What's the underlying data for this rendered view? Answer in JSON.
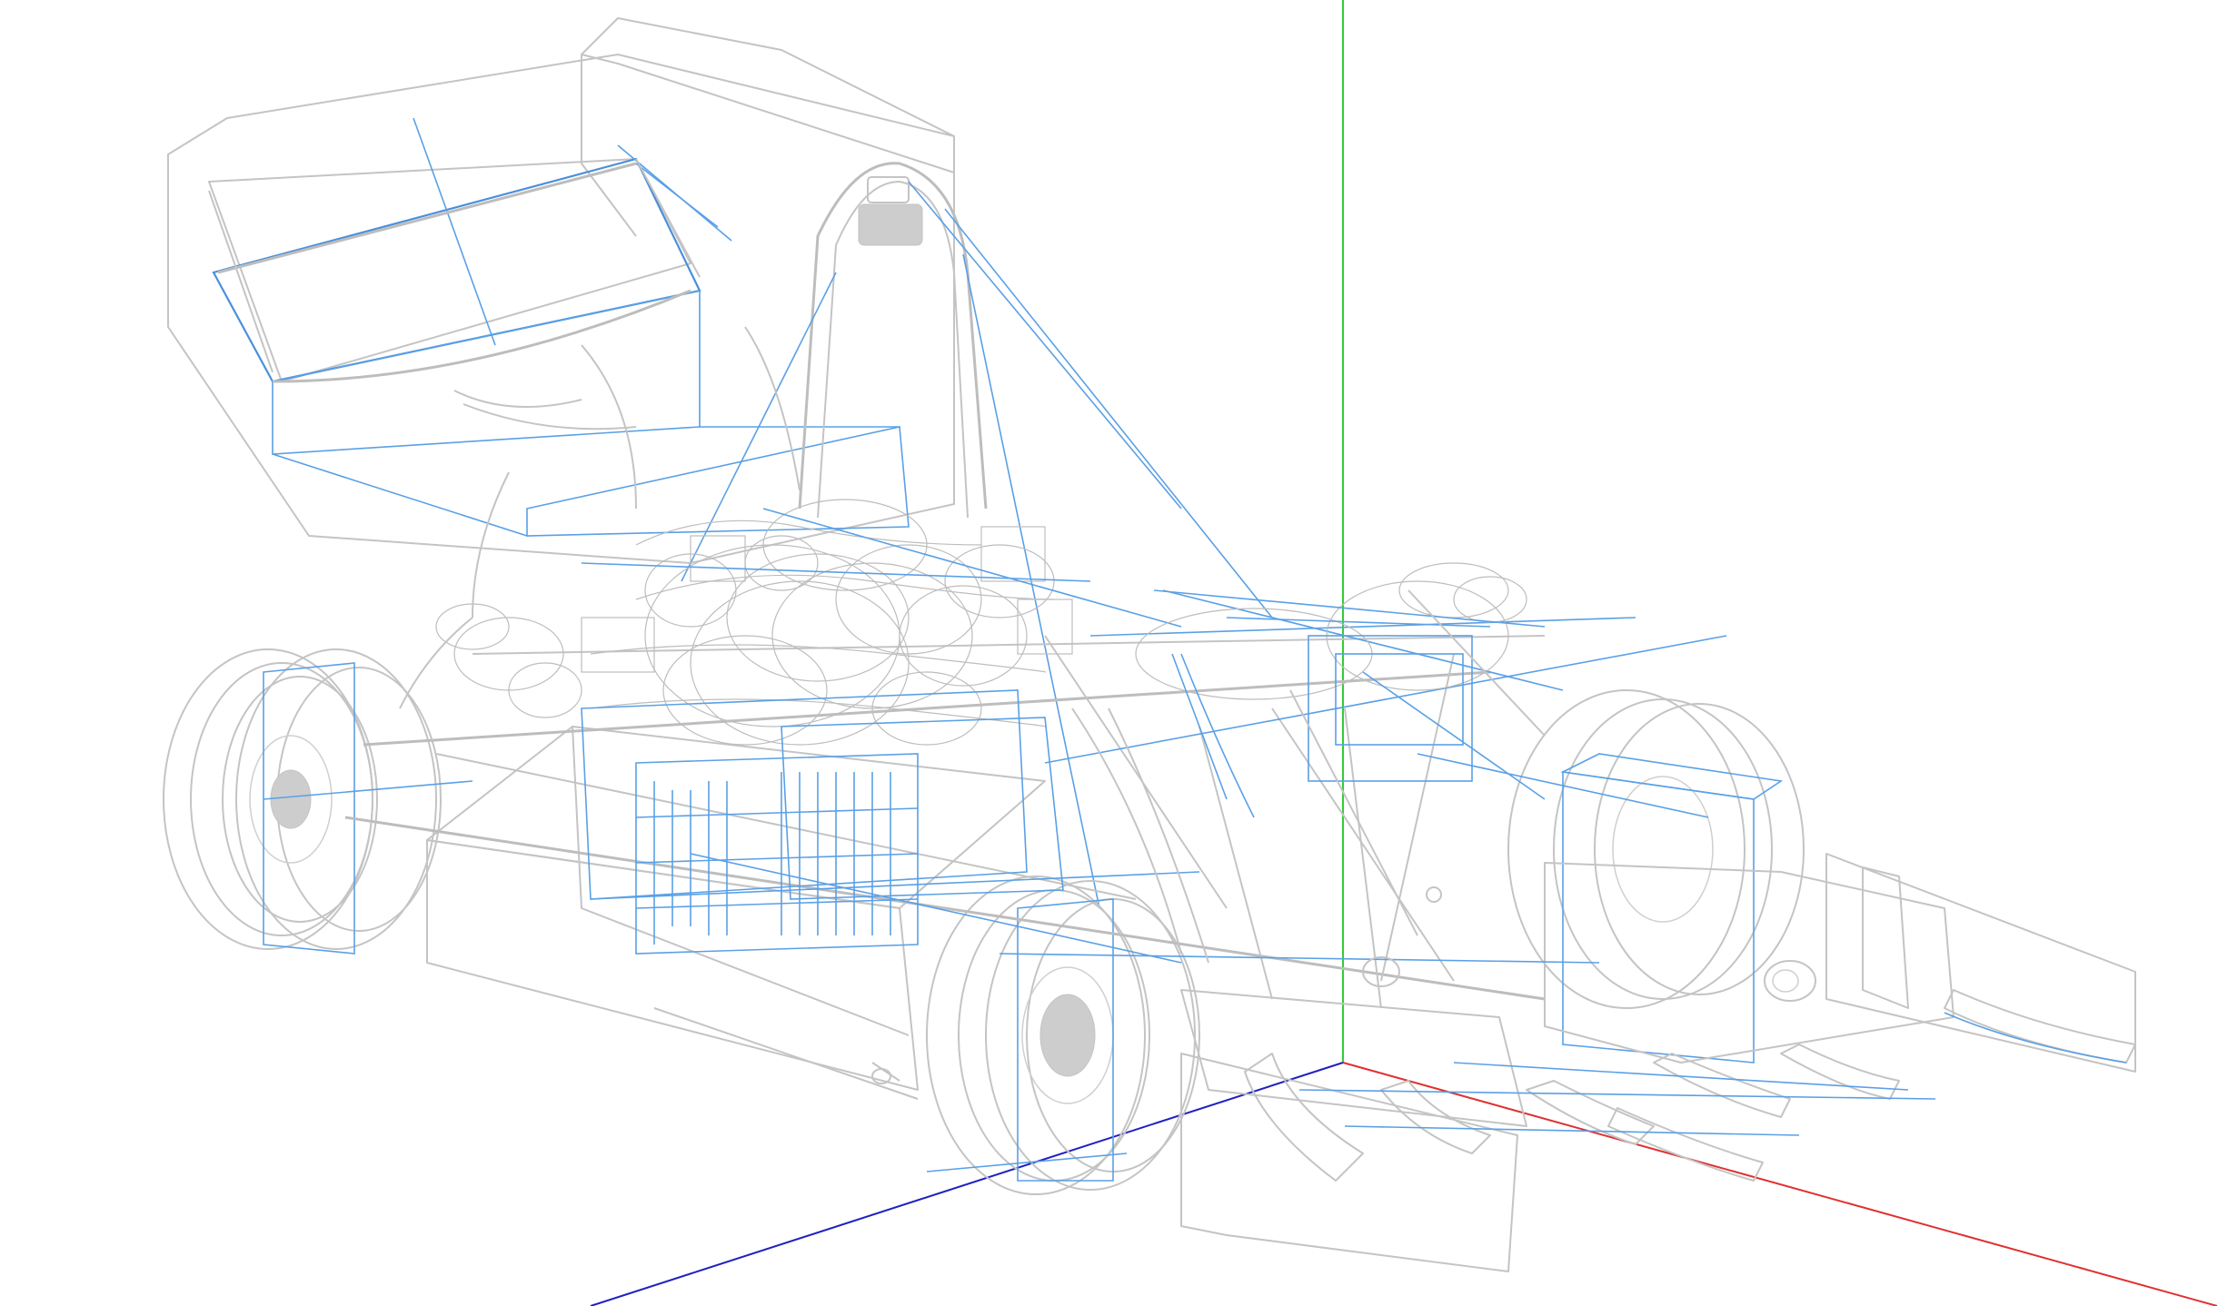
{
  "viewport": {
    "background": "#ffffff",
    "render_mode": "wireframe"
  },
  "model": {
    "colors": {
      "geometry": "#c4c4c4",
      "selection": "#5aa0e6"
    }
  },
  "axes": {
    "x_color": "#e03030",
    "y_color": "#33cc33",
    "z_color": "#2020c0"
  }
}
